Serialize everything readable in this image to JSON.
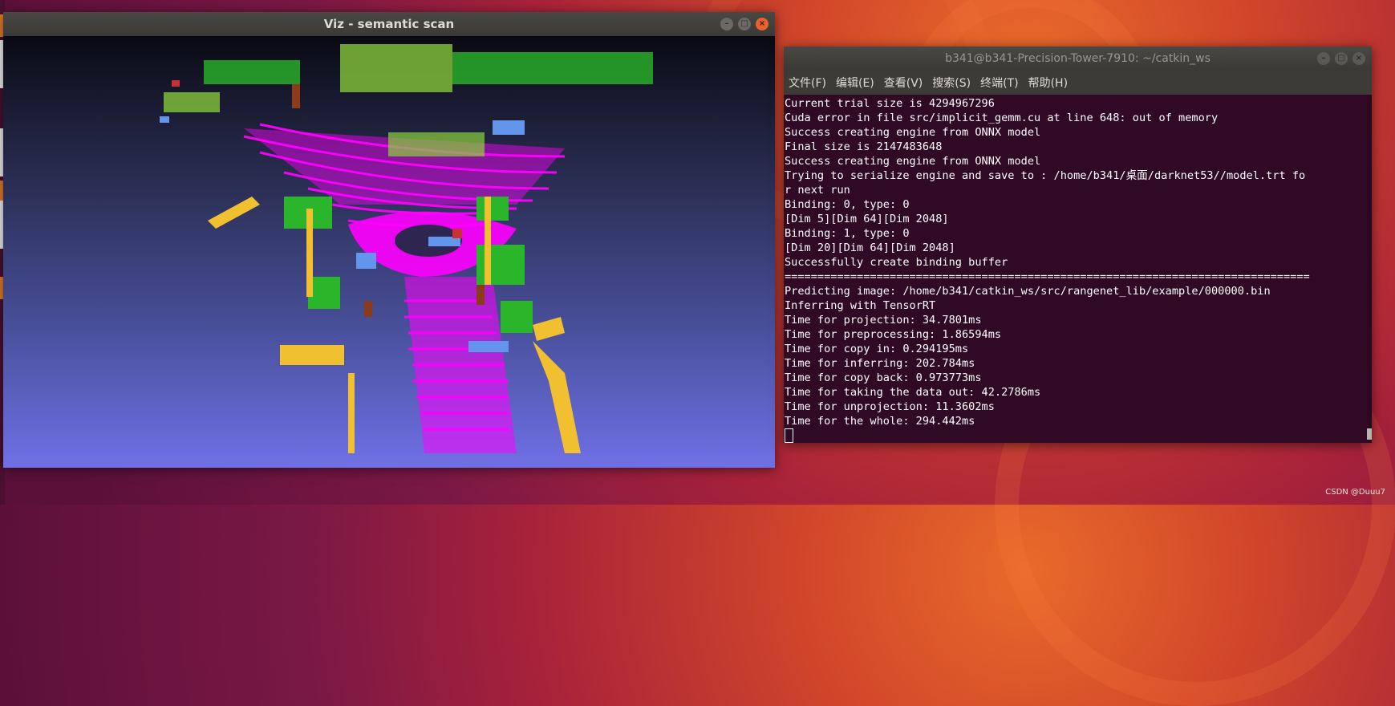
{
  "viz_window": {
    "title": "Viz - semantic scan"
  },
  "terminal": {
    "title": "b341@b341-Precision-Tower-7910: ~/catkin_ws",
    "menu": [
      "文件(F)",
      "编辑(E)",
      "查看(V)",
      "搜索(S)",
      "终端(T)",
      "帮助(H)"
    ],
    "lines": [
      "Current trial size is 4294967296",
      "Cuda error in file src/implicit_gemm.cu at line 648: out of memory",
      "Success creating engine from ONNX model",
      "Final size is 2147483648",
      "Success creating engine from ONNX model",
      "Trying to serialize engine and save to : /home/b341/桌面/darknet53//model.trt fo",
      "r next run",
      "Binding: 0, type: 0",
      "[Dim 5][Dim 64][Dim 2048]",
      "Binding: 1, type: 0",
      "[Dim 20][Dim 64][Dim 2048]",
      "Successfully create binding buffer",
      "================================================================================",
      "Predicting image: /home/b341/catkin_ws/src/rangenet_lib/example/000000.bin",
      "Inferring with TensorRT",
      "Time for projection: 34.7801ms",
      "Time for preprocessing: 1.86594ms",
      "Time for copy in: 0.294195ms",
      "Time for inferring: 202.784ms",
      "Time for copy back: 0.973773ms",
      "Time for taking the data out: 42.2786ms",
      "Time for unprojection: 11.3602ms",
      "Time for the whole: 294.442ms"
    ]
  },
  "window_controls": {
    "minimize": "–",
    "maximize": "□",
    "close": "×"
  },
  "watermark": "CSDN @Duuu7",
  "colors": {
    "road": "#ff00ff",
    "sidewalk": "#d860e0",
    "vegetation": "#2bb52b",
    "terrain": "#8cd23c",
    "pole": "#f0c030",
    "car": "#6495ed",
    "trunk": "#8b3a1a",
    "building": "#c83232"
  }
}
